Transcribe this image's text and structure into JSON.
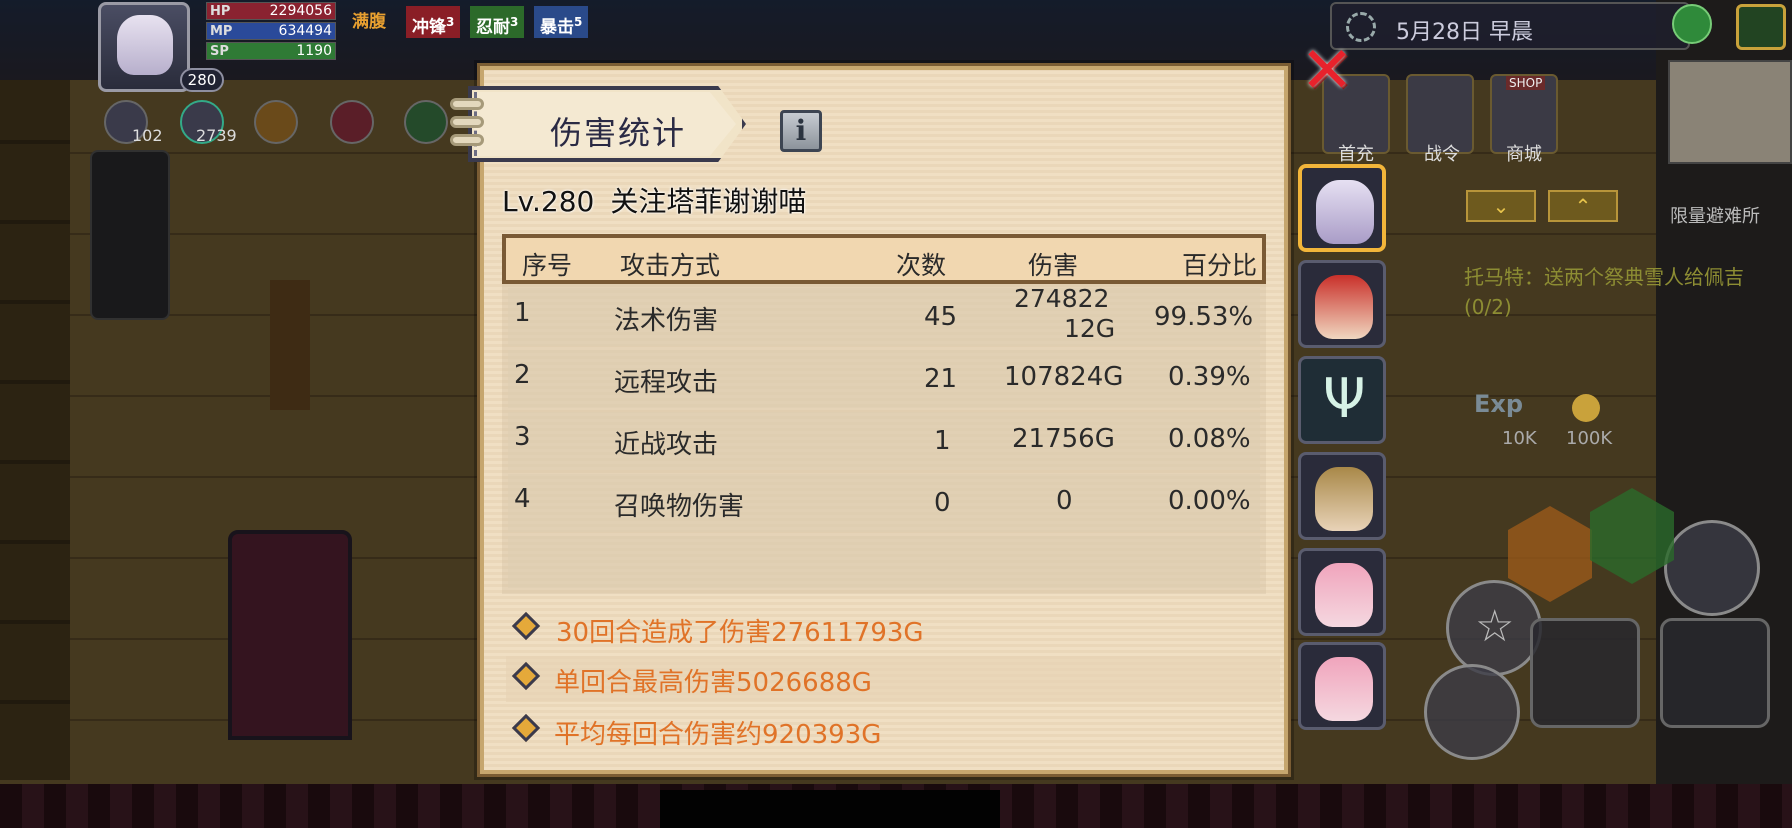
{
  "hud": {
    "level": "280",
    "hp_label": "HP",
    "hp_value": "2294056",
    "mp_label": "MP",
    "mp_value": "634494",
    "sp_label": "SP",
    "sp_value": "1190",
    "status_tags": [
      {
        "label": "满腹",
        "color": "#e8a030"
      },
      {
        "label": "冲锋",
        "sup": "3",
        "color": "#c0303a"
      },
      {
        "label": "忍耐",
        "sup": "3",
        "color": "#3c9a3a"
      },
      {
        "label": "暴击",
        "sup": "5",
        "color": "#3a6ac0"
      }
    ],
    "skill_counts": [
      "102",
      "2739"
    ]
  },
  "topright": {
    "date": "5月28日 早晨",
    "shop_label": "SHOP",
    "buttons": [
      "首充",
      "战令",
      "商城"
    ],
    "limit_label": "限量避难所",
    "arrow_down": "⌄",
    "arrow_up": "⌃"
  },
  "quest": {
    "text": "托马特：送两个祭典雪人给佩吉",
    "progress": "(0/2)",
    "exp_label": "Exp",
    "exp_value": "10K",
    "gold_value": "100K"
  },
  "panel": {
    "title": "伤害统计",
    "info": "i",
    "close": "✕",
    "character_level": "Lv.280",
    "character_name": "关注塔菲谢谢喵",
    "columns": [
      "序号",
      "攻击方式",
      "次数",
      "伤害",
      "百分比"
    ],
    "rows": [
      {
        "idx": "1",
        "type": "法术伤害",
        "count": "45",
        "damage_line1": "274822",
        "damage_line2": "12G",
        "percent": "99.53%"
      },
      {
        "idx": "2",
        "type": "远程攻击",
        "count": "21",
        "damage_line1": "107824G",
        "damage_line2": "",
        "percent": "0.39%"
      },
      {
        "idx": "3",
        "type": "近战攻击",
        "count": "1",
        "damage_line1": "21756G",
        "damage_line2": "",
        "percent": "0.08%"
      },
      {
        "idx": "4",
        "type": "召唤物伤害",
        "count": "0",
        "damage_line1": "0",
        "damage_line2": "",
        "percent": "0.00%"
      }
    ],
    "summary": [
      "30回合造成了伤害27611793G",
      "单回合最高伤害5026688G",
      "平均每回合伤害约920393G"
    ]
  },
  "colors": {
    "panel_bg": "#f0dfc3",
    "summary_text": "#e07328",
    "selected_border": "#f2b53a",
    "close_red": "#e8222c"
  }
}
